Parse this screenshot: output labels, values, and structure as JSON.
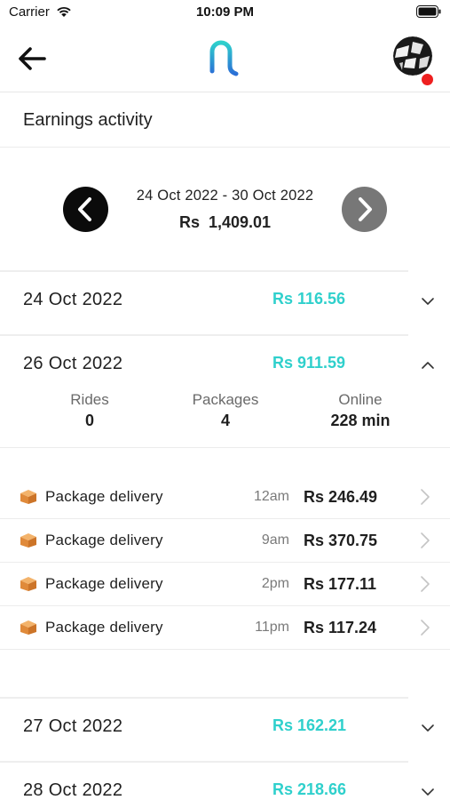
{
  "status_bar": {
    "carrier": "Carrier",
    "time": "10:09 PM"
  },
  "header": {
    "back_icon": "arrow-left-icon",
    "logo_icon": "brand-logo",
    "avatar_icon": "globe-avatar",
    "notification_color": "#ee1f1f"
  },
  "page": {
    "title": "Earnings activity"
  },
  "week": {
    "range": "24 Oct 2022 - 30 Oct 2022",
    "currency": "Rs",
    "total": "1,409.01",
    "prev_icon": "chevron-left-icon",
    "next_icon": "chevron-right-icon"
  },
  "days": [
    {
      "date": "24 Oct 2022",
      "amount": "Rs 116.56",
      "expanded": false
    },
    {
      "date": "26 Oct 2022",
      "amount": "Rs 911.59",
      "expanded": true
    },
    {
      "date": "27 Oct 2022",
      "amount": "Rs 162.21",
      "expanded": false
    },
    {
      "date": "28 Oct 2022",
      "amount": "Rs 218.66",
      "expanded": false
    }
  ],
  "stats": {
    "rides": {
      "label": "Rides",
      "value": "0"
    },
    "packages": {
      "label": "Packages",
      "value": "4"
    },
    "online": {
      "label": "Online",
      "value": "228 min"
    }
  },
  "trips": [
    {
      "type": "Package delivery",
      "time": "12am",
      "fare": "Rs 246.49",
      "icon": "package-icon"
    },
    {
      "type": "Package delivery",
      "time": "9am",
      "fare": "Rs 370.75",
      "icon": "package-icon"
    },
    {
      "type": "Package delivery",
      "time": "2pm",
      "fare": "Rs 177.11",
      "icon": "package-icon"
    },
    {
      "type": "Package delivery",
      "time": "11pm",
      "fare": "Rs 117.24",
      "icon": "package-icon"
    }
  ],
  "colors": {
    "accent": "#2fd0cc",
    "nav_prev": "#0b0b0b",
    "nav_next": "#777777"
  }
}
